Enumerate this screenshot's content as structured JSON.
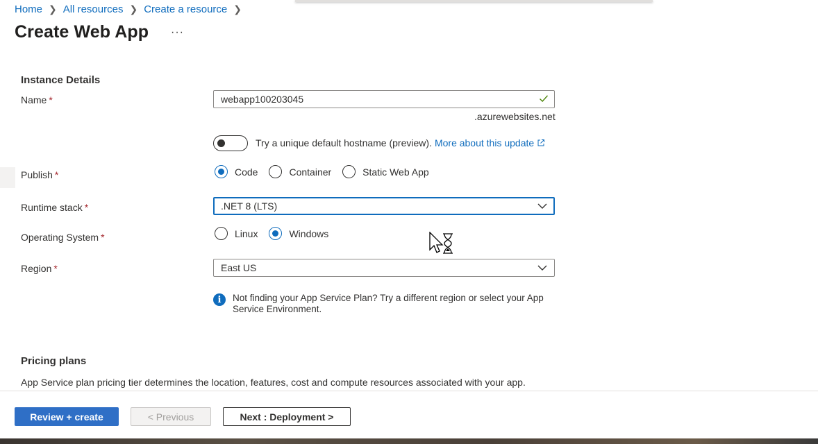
{
  "breadcrumb": {
    "items": [
      "Home",
      "All resources",
      "Create a resource"
    ]
  },
  "page": {
    "title": "Create Web App",
    "more_label": "···"
  },
  "instance_details": {
    "heading": "Instance Details",
    "name": {
      "label": "Name",
      "required": "*",
      "value": "webapp100203045",
      "suffix": ".azurewebsites.net"
    },
    "hostname_toggle": {
      "text": "Try a unique default hostname (preview).",
      "link": "More about this update",
      "state": "off"
    },
    "publish": {
      "label": "Publish",
      "required": "*",
      "options": [
        "Code",
        "Container",
        "Static Web App"
      ],
      "selected": "Code"
    },
    "runtime_stack": {
      "label": "Runtime stack",
      "required": "*",
      "value": ".NET 8 (LTS)"
    },
    "operating_system": {
      "label": "Operating System",
      "required": "*",
      "options": [
        "Linux",
        "Windows"
      ],
      "selected": "Windows"
    },
    "region": {
      "label": "Region",
      "required": "*",
      "value": "East US"
    },
    "region_info": "Not finding your App Service Plan? Try a different region or select your App Service Environment."
  },
  "pricing": {
    "heading": "Pricing plans",
    "description": "App Service plan pricing tier determines the location, features, cost and compute resources associated with your app."
  },
  "footer": {
    "review_create": "Review + create",
    "previous": "< Previous",
    "next": "Next : Deployment >"
  },
  "colors": {
    "accent": "#0f6cbd",
    "primary_button": "#2f6fc6",
    "required": "#a4262c",
    "valid_check": "#498205"
  }
}
